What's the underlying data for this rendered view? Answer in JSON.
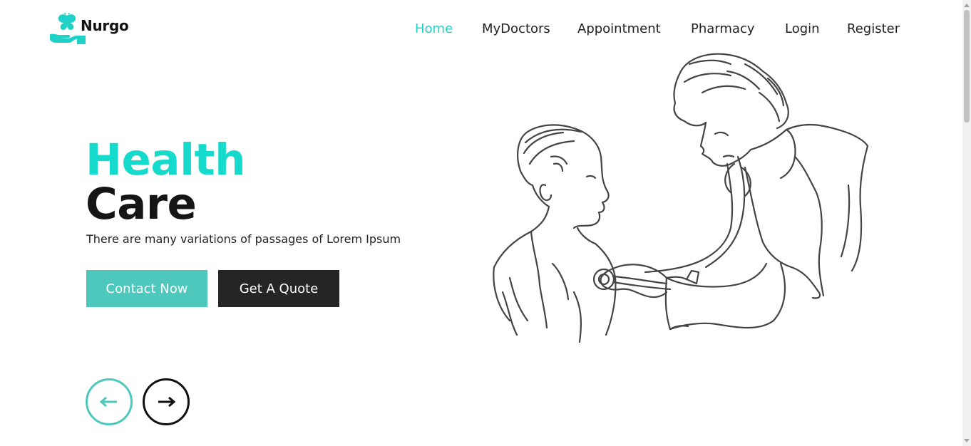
{
  "brand": {
    "name": "Nurgo",
    "accent_color": "#1fd1c6",
    "icon": "hand-butterfly-icon"
  },
  "nav": {
    "items": [
      {
        "label": "Home",
        "active": true
      },
      {
        "label": "MyDoctors",
        "active": false
      },
      {
        "label": "Appointment",
        "active": false
      },
      {
        "label": "Pharmacy",
        "active": false
      },
      {
        "label": "Login",
        "active": false
      },
      {
        "label": "Register",
        "active": false
      }
    ]
  },
  "hero": {
    "title_line1": "Health",
    "title_line2": "Care",
    "subtitle": "There are many variations of passages of Lorem Ipsum",
    "contact_button": "Contact Now",
    "quote_button": "Get A Quote",
    "prev_icon": "arrow-left-icon",
    "next_icon": "arrow-right-icon",
    "illustration": "doctor-with-stethoscope-examining-boy-sketch"
  },
  "colors": {
    "teal": "#16dbcc",
    "button_teal": "#4ec8bc",
    "dark": "#252525"
  }
}
